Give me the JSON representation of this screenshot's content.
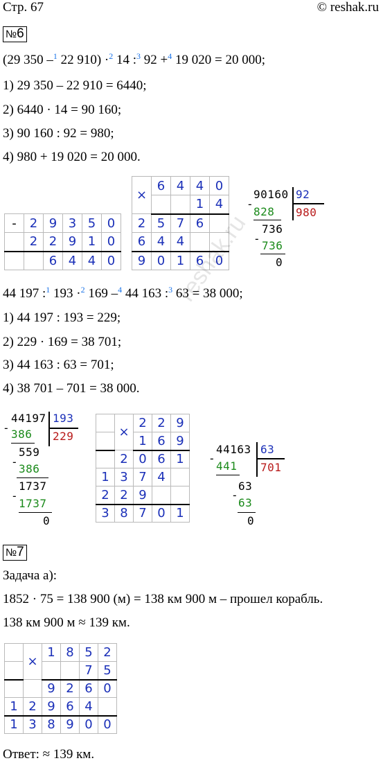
{
  "header": {
    "page": "Стр. 67",
    "site": "© reshak.ru"
  },
  "task6": {
    "number_label": "№",
    "number": "6",
    "expr1": {
      "a": "(29 350 –",
      "o1": "1",
      "b": " 22 910) ·",
      "o2": "2",
      "c": " 14 :",
      "o3": "3",
      "d": " 92 +",
      "o4": "4",
      "e": " 19 020 = 20 000;"
    },
    "steps1": [
      "1) 29 350 – 22 910 = 6440;",
      "2) 6440 · 14 = 90 160;",
      "3) 90 160 : 92 = 980;",
      "4) 980 + 19 020 = 20 000."
    ],
    "sub1": {
      "sign": "-",
      "row1": [
        "2",
        "9",
        "3",
        "5",
        "0"
      ],
      "row2": [
        "2",
        "2",
        "9",
        "1",
        "0"
      ],
      "row3": [
        "6",
        "4",
        "4",
        "0"
      ]
    },
    "mul1": {
      "sign": "×",
      "row1": [
        "6",
        "4",
        "4",
        "0"
      ],
      "row2": [
        "1",
        "4"
      ],
      "row3": [
        "2",
        "5",
        "7",
        "6"
      ],
      "row4": [
        "6",
        "4",
        "4"
      ],
      "row5": [
        "9",
        "0",
        "1",
        "6",
        "0"
      ]
    },
    "div1": {
      "dividend": "90160",
      "divisor": "92",
      "sub1": "828",
      "quotient": "980",
      "rem1": "736",
      "sub2": "736",
      "rem2": "0",
      "minus": "-"
    },
    "expr2": {
      "a": "44 197 :",
      "o1": "1",
      "b": " 193 ·",
      "o2": "2",
      "c": " 169 –",
      "o4": "4",
      "d": " 44 163 :",
      "o3": "3",
      "e": " 63 = 38 000;"
    },
    "steps2": [
      "1) 44 197 : 193 = 229;",
      "2) 229 · 169 = 38 701;",
      "3) 44 163 : 63 = 701;",
      "4) 38 701 – 701 = 38 000."
    ],
    "div2": {
      "dividend": "44197",
      "divisor": "193",
      "sub1": "386",
      "quotient": "229",
      "rem1": "559",
      "sub2": "386",
      "rem2": "1737",
      "sub3": "1737",
      "rem3": "0",
      "minus": "-"
    },
    "mul2": {
      "sign": "×",
      "row1": [
        "2",
        "2",
        "9"
      ],
      "row2": [
        "1",
        "6",
        "9"
      ],
      "row3": [
        "2",
        "0",
        "6",
        "1"
      ],
      "row4": [
        "1",
        "3",
        "7",
        "4"
      ],
      "row5": [
        "2",
        "2",
        "9"
      ],
      "row6": [
        "3",
        "8",
        "7",
        "0",
        "1"
      ]
    },
    "div3": {
      "dividend": "44163",
      "divisor": "63",
      "sub1": "441",
      "quotient": "701",
      "rem1": "63",
      "sub2": "63",
      "rem2": "0",
      "minus": "-"
    }
  },
  "task7": {
    "number_label": "№",
    "number": "7",
    "task_label": "Задача а):",
    "line1": "1852 · 75 = 138 900 (м) = 138 км 900 м – прошел корабль.",
    "line2": "138 км 900 м ≈ 139 км.",
    "mul": {
      "sign": "×",
      "row1": [
        "1",
        "8",
        "5",
        "2"
      ],
      "row2": [
        "7",
        "5"
      ],
      "row3": [
        "9",
        "2",
        "6",
        "0"
      ],
      "row4": [
        "1",
        "2",
        "9",
        "6",
        "4"
      ],
      "row5": [
        "1",
        "3",
        "8",
        "9",
        "0",
        "0"
      ]
    },
    "answer": "Ответ: ≈ 139 км."
  },
  "watermark": "reshak.ru"
}
